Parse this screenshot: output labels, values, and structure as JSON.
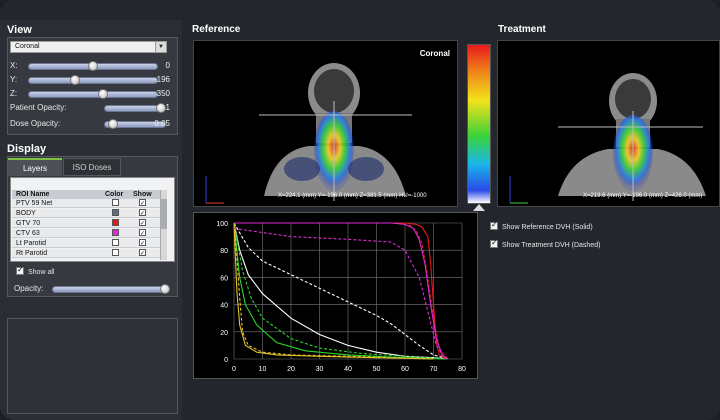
{
  "panels": {
    "view": "View",
    "display": "Display",
    "reference": "Reference",
    "treatment": "Treatment"
  },
  "view_controls": {
    "orientation": "Coronal",
    "sliders": [
      {
        "label": "X:",
        "value": "0",
        "level": 0.5
      },
      {
        "label": "Y:",
        "value": "-196",
        "level": 0.35
      },
      {
        "label": "Z:",
        "value": "350",
        "level": 0.58
      },
      {
        "label": "Patient Opacity:",
        "value": "1",
        "level": 1.0
      },
      {
        "label": "Dose Opacity:",
        "value": "0.05",
        "level": 0.08
      }
    ]
  },
  "display": {
    "tabs": [
      "Layers",
      "ISO Doses"
    ],
    "active_tab": "Layers",
    "columns": [
      "ROI Name",
      "Color",
      "Show"
    ],
    "rois": [
      {
        "name": "PTV 59 Net",
        "color": "#ffffff",
        "show": true
      },
      {
        "name": "BODY",
        "color": "#5a6e86",
        "show": true
      },
      {
        "name": "GTV 70",
        "color": "#e01c1c",
        "show": true
      },
      {
        "name": "CTV 63",
        "color": "#e02ad6",
        "show": true
      },
      {
        "name": "Lt Parotid",
        "color": "#ffffff",
        "show": true
      },
      {
        "name": "Rt Parotid",
        "color": "#ffffff",
        "show": true
      }
    ],
    "show_all": "Show all",
    "opacity_label": "Opacity:",
    "opacity_level": 1.0
  },
  "reference": {
    "label": "Coronal",
    "readout": "X=224.1 (mm) Y=-196.0 (mm) Z=381.5 (mm) HU=-1000"
  },
  "treatment": {
    "readout": "X=219.6 (mm) Y=-196.0 (mm) Z=426.0 (mm)"
  },
  "options": {
    "show_reference": "Show Reference DVH (Solid)",
    "show_treatment": "Show Treatment DVH (Dashed)"
  },
  "colors": {
    "accent_green": "#7fc241",
    "panel_bg": "#2a2e34"
  },
  "chart_data": {
    "type": "line",
    "xlim": [
      0,
      80
    ],
    "ylim": [
      0,
      100
    ],
    "x_ticks": [
      "0",
      "10",
      "20",
      "30",
      "40",
      "50",
      "60",
      "70",
      "80"
    ],
    "y_ticks": [
      "0",
      "20",
      "40",
      "60",
      "80",
      "100"
    ],
    "grid": true,
    "series": [
      {
        "color": "#ffffff",
        "style": "solid",
        "x": [
          0,
          2,
          5,
          10,
          20,
          30,
          40,
          50,
          60,
          70,
          75
        ],
        "y": [
          100,
          80,
          62,
          48,
          30,
          18,
          10,
          5,
          2,
          1,
          0
        ]
      },
      {
        "color": "#ffffff",
        "style": "dashed",
        "x": [
          0,
          5,
          10,
          20,
          30,
          40,
          50,
          55,
          60,
          65,
          70,
          75
        ],
        "y": [
          100,
          82,
          72,
          62,
          52,
          42,
          32,
          26,
          18,
          10,
          3,
          0
        ]
      },
      {
        "color": "#2bd62b",
        "style": "solid",
        "x": [
          0,
          2,
          4,
          8,
          15,
          25,
          40,
          60,
          75
        ],
        "y": [
          100,
          60,
          40,
          25,
          12,
          6,
          3,
          1,
          0
        ]
      },
      {
        "color": "#2bd62b",
        "style": "dashed",
        "x": [
          0,
          3,
          6,
          10,
          20,
          30,
          45,
          60,
          75
        ],
        "y": [
          100,
          65,
          45,
          30,
          15,
          8,
          4,
          2,
          0
        ]
      },
      {
        "color": "#e3c22a",
        "style": "solid",
        "x": [
          0,
          1,
          2,
          4,
          8,
          15,
          30,
          50,
          70
        ],
        "y": [
          100,
          50,
          25,
          10,
          5,
          3,
          2,
          1,
          0
        ]
      },
      {
        "color": "#e3c22a",
        "style": "dashed",
        "x": [
          0,
          1,
          2,
          3,
          5,
          10,
          20,
          40,
          70
        ],
        "y": [
          100,
          75,
          45,
          20,
          10,
          5,
          3,
          2,
          0
        ]
      },
      {
        "color": "#e01c1c",
        "style": "solid",
        "x": [
          0,
          60,
          64,
          66,
          68,
          69,
          70,
          71,
          72,
          75
        ],
        "y": [
          100,
          100,
          99,
          97,
          90,
          70,
          40,
          12,
          3,
          0
        ]
      },
      {
        "color": "#e01c1c",
        "style": "dashed",
        "x": [
          0,
          58,
          62,
          64,
          66,
          68,
          70,
          72,
          75
        ],
        "y": [
          100,
          100,
          98,
          94,
          85,
          60,
          30,
          8,
          0
        ]
      },
      {
        "color": "#e02ad6",
        "style": "solid",
        "x": [
          0,
          55,
          60,
          63,
          65,
          67,
          69,
          71,
          73,
          75
        ],
        "y": [
          100,
          100,
          99,
          96,
          88,
          70,
          40,
          15,
          3,
          0
        ]
      },
      {
        "color": "#e02ad6",
        "style": "dashed",
        "x": [
          0,
          10,
          20,
          40,
          55,
          60,
          65,
          68,
          71,
          74
        ],
        "y": [
          96,
          93,
          90,
          88,
          86,
          80,
          60,
          35,
          10,
          0
        ]
      }
    ]
  }
}
